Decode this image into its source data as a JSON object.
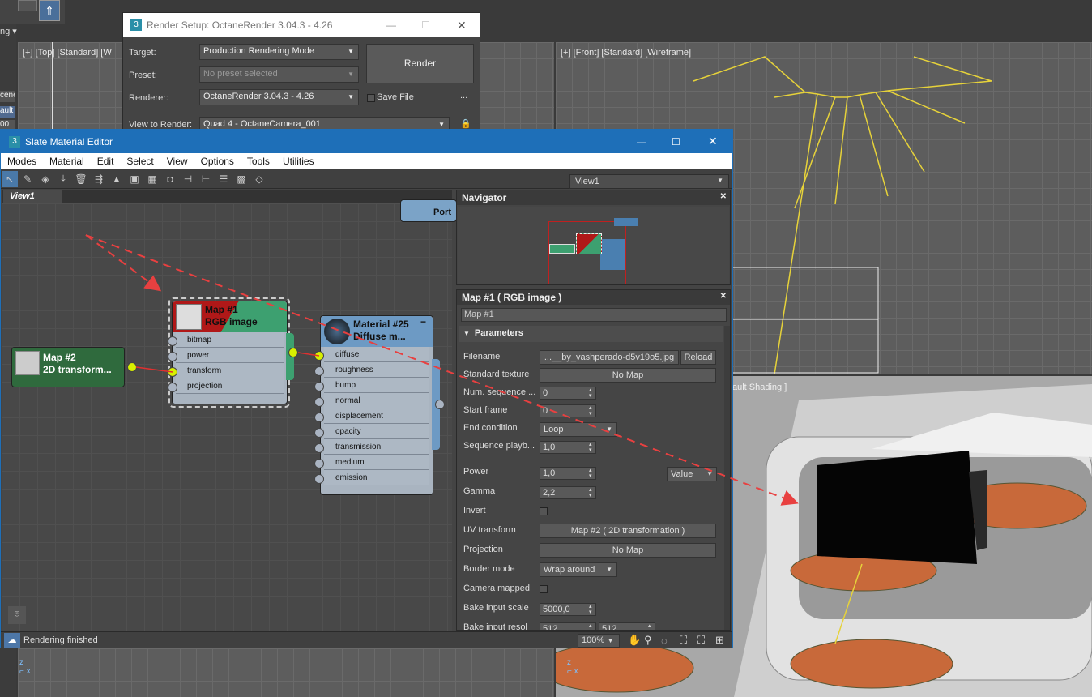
{
  "left_panel": {
    "label": "ng",
    "items": [
      "cene",
      "ault",
      "00"
    ]
  },
  "viewport_top": {
    "label": "[+] [Top] [Standard] [W"
  },
  "viewport_front": {
    "label": "[+] [Front] [Standard] [Wireframe]"
  },
  "viewport_persp": {
    "label": "ault Shading ]"
  },
  "render_setup": {
    "title": "Render Setup: OctaneRender 3.04.3 - 4.26",
    "target_label": "Target:",
    "target_value": "Production Rendering Mode",
    "preset_label": "Preset:",
    "preset_value": "No preset selected",
    "renderer_label": "Renderer:",
    "renderer_value": "OctaneRender 3.04.3 - 4.26",
    "view_label": "View to Render:",
    "view_value": "Quad 4 - OctaneCamera_001",
    "render_button": "Render",
    "save_file": "Save File",
    "more": "..."
  },
  "slate": {
    "title": "Slate Material Editor",
    "menu": [
      "Modes",
      "Material",
      "Edit",
      "Select",
      "View",
      "Options",
      "Tools",
      "Utilities"
    ],
    "view_dropdown": "View1",
    "view_tab": "View1",
    "port_label": "Port",
    "nodes": {
      "map2": {
        "name": "Map #2",
        "type": "2D transform..."
      },
      "map1": {
        "name": "Map #1",
        "type": "RGB image",
        "slots": [
          "bitmap",
          "power",
          "transform",
          "projection"
        ]
      },
      "material": {
        "name": "Material #25",
        "type": "Diffuse m...",
        "slots": [
          "diffuse",
          "roughness",
          "bump",
          "normal",
          "displacement",
          "opacity",
          "transmission",
          "medium",
          "emission"
        ]
      }
    },
    "navigator": {
      "title": "Navigator"
    },
    "params": {
      "title": "Map #1  ( RGB image )",
      "name_field": "Map #1",
      "section": "Parameters",
      "rows": {
        "filename_label": "Filename",
        "filename_value": "...__by_vashperado-d5v19o5.jpg",
        "reload": "Reload",
        "std_texture_label": "Standard texture",
        "std_texture_value": "No Map",
        "num_seq_label": "Num. sequence ...",
        "num_seq_value": "0",
        "start_frame_label": "Start frame",
        "start_frame_value": "0",
        "end_cond_label": "End condition",
        "end_cond_value": "Loop",
        "seq_play_label": "Sequence playb...",
        "seq_play_value": "1,0",
        "power_label": "Power",
        "power_value": "1,0",
        "power_mode": "Value",
        "gamma_label": "Gamma",
        "gamma_value": "2,2",
        "invert_label": "Invert",
        "uv_label": "UV transform",
        "uv_value": "Map #2  ( 2D transformation )",
        "proj_label": "Projection",
        "proj_value": "No Map",
        "border_label": "Border mode",
        "border_value": "Wrap around",
        "cam_label": "Camera mapped",
        "bake_scale_label": "Bake input scale",
        "bake_scale_value": "5000,0",
        "bake_res_label": "Bake input resol",
        "bake_res_value1": "512",
        "bake_res_value2": "512"
      }
    },
    "status": {
      "text": "Rendering finished",
      "zoom": "100%"
    }
  },
  "colors": {
    "accent": "#1e6fb8",
    "socket_active": "#d8f000",
    "arrow": "#e84040"
  }
}
